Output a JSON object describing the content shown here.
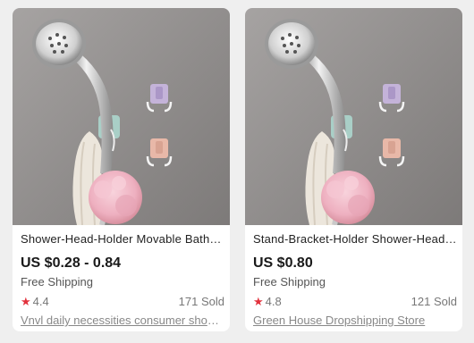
{
  "products": [
    {
      "title": "Shower-Head-Holder Movable Bathroom Holder",
      "price": "US $0.28 - 0.84",
      "shipping": "Free Shipping",
      "rating": "4.4",
      "sold": "171 Sold",
      "store": "Vnvl daily necessities consumer shop Store",
      "image_icon": "shower-head-holder-photo-icon"
    },
    {
      "title": "Stand-Bracket-Holder Shower-Head Holder",
      "price": "US $0.80",
      "shipping": "Free Shipping",
      "rating": "4.8",
      "sold": "121 Sold",
      "store": "Green House Dropshipping Store",
      "image_icon": "shower-head-holder-photo-icon"
    }
  ],
  "colors": {
    "star": "#e2323d",
    "wall": "#8d8a89",
    "hook_purple": "#c4b3d9",
    "hook_pink": "#e8b8a8",
    "sponge": "#f0b7c5"
  }
}
